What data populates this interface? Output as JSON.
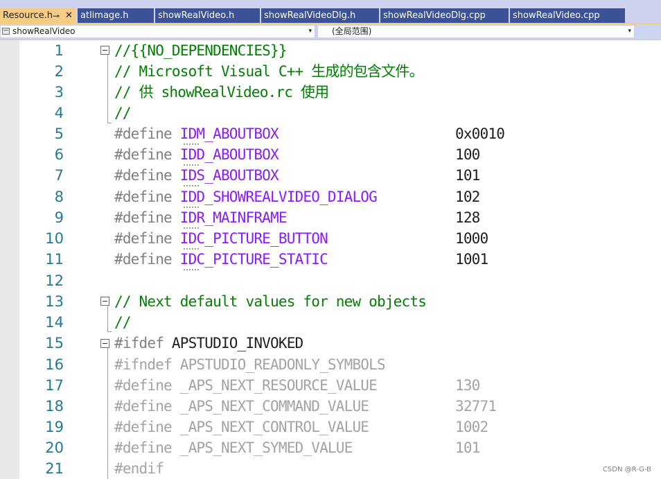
{
  "tabs": [
    {
      "label": "Resource.h",
      "pin": "⊸",
      "close": "✕"
    },
    {
      "label": "atlimage.h"
    },
    {
      "label": "showRealVideo.h"
    },
    {
      "label": "showRealVideoDlg.h"
    },
    {
      "label": "showRealVideoDlg.cpp"
    },
    {
      "label": "showRealVideo.cpp"
    }
  ],
  "nav": {
    "project": "showRealVideo",
    "scope": "(全局范围)",
    "arrow": "▾"
  },
  "lines": [
    {
      "n": "1",
      "text": "//{{NO_DEPENDENCIES}}"
    },
    {
      "n": "2",
      "text": "// Microsoft Visual C++ 生成的包含文件。"
    },
    {
      "n": "3",
      "text": "// 供 showRealVideo.rc 使用"
    },
    {
      "n": "4",
      "text": "//"
    },
    {
      "n": "5",
      "kw": "#define ",
      "name": "IDM_ABOUTBOX",
      "value": "0x0010"
    },
    {
      "n": "6",
      "kw": "#define ",
      "name": "IDD_ABOUTBOX",
      "value": "100"
    },
    {
      "n": "7",
      "kw": "#define ",
      "name": "IDS_ABOUTBOX",
      "value": "101"
    },
    {
      "n": "8",
      "kw": "#define ",
      "name": "IDD_SHOWREALVIDEO_DIALOG",
      "value": "102"
    },
    {
      "n": "9",
      "kw": "#define ",
      "name": "IDR_MAINFRAME",
      "value": "128"
    },
    {
      "n": "10",
      "kw": "#define ",
      "name": "IDC_PICTURE_BUTTON",
      "value": "1000"
    },
    {
      "n": "11",
      "kw": "#define ",
      "name": "IDC_PICTURE_STATIC",
      "value": "1001"
    },
    {
      "n": "12",
      "text": ""
    },
    {
      "n": "13",
      "text": "// Next default values for new objects"
    },
    {
      "n": "14",
      "text": "//"
    },
    {
      "n": "15",
      "kw": "#ifdef ",
      "name": "APSTUDIO_INVOKED"
    },
    {
      "n": "16",
      "text": "#ifndef APSTUDIO_READONLY_SYMBOLS"
    },
    {
      "n": "17",
      "text": "#define _APS_NEXT_RESOURCE_VALUE",
      "value": "130"
    },
    {
      "n": "18",
      "text": "#define _APS_NEXT_COMMAND_VALUE",
      "value": "32771"
    },
    {
      "n": "19",
      "text": "#define _APS_NEXT_CONTROL_VALUE",
      "value": "1002"
    },
    {
      "n": "20",
      "text": "#define _APS_NEXT_SYMED_VALUE",
      "value": "101"
    },
    {
      "n": "21",
      "text": "#endif"
    }
  ],
  "watermark": "CSDN @R-G-B",
  "colors": {
    "comment": "#008000",
    "macro": "#8a1bff",
    "keyword": "#808080",
    "inactive": "#a3a3a3",
    "line_number": "#237893",
    "active_tab": "#f5cc84",
    "tab": "#3b5396"
  }
}
